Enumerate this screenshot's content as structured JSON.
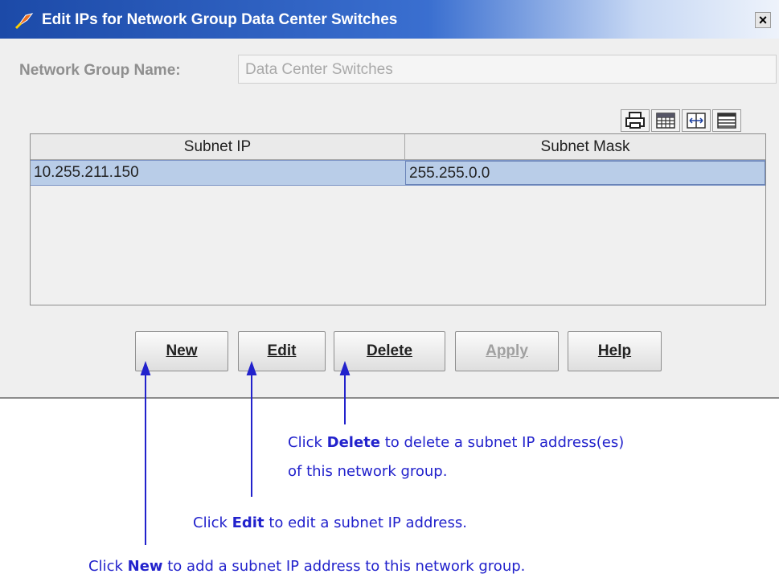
{
  "dialog": {
    "title": "Edit IPs for Network Group Data Center Switches",
    "close_label": "×",
    "group_name_label": "Network Group Name:",
    "group_name_value": "Data Center Switches"
  },
  "toolbar": {
    "icons": [
      "print-icon",
      "table-grid-icon",
      "column-resize-icon",
      "table-layout-icon"
    ]
  },
  "table": {
    "columns": [
      "Subnet IP",
      "Subnet Mask"
    ],
    "rows": [
      {
        "subnet_ip": "10.255.211.150",
        "subnet_mask": "255.255.0.0"
      }
    ]
  },
  "buttons": {
    "new": "New",
    "edit": "Edit",
    "delete": "Delete",
    "apply": "Apply",
    "help": "Help"
  },
  "annotations": {
    "delete_prefix": "Click ",
    "delete_key": "Delete",
    "delete_suffix": " to delete a subnet IP address(es)",
    "delete_line2": "of this network group.",
    "edit_prefix": "Click ",
    "edit_key": "Edit",
    "edit_suffix": " to edit a subnet IP address.",
    "new_prefix": "Click ",
    "new_key": "New",
    "new_suffix": " to add a subnet IP address to this network group."
  },
  "colors": {
    "title_bar": "#1c4aa8",
    "selected_row": "#b9cde8",
    "annotation_text": "#2222cc"
  }
}
